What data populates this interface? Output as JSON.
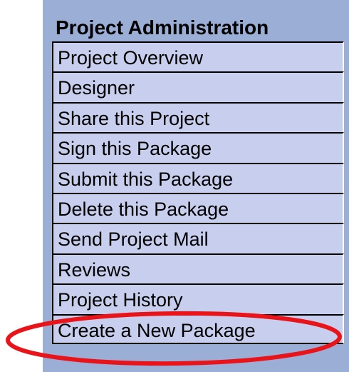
{
  "panel": {
    "title": "Project Administration",
    "background_color": "#9aaed6",
    "item_color": "#c8cfee"
  },
  "menu": {
    "items": [
      {
        "id": "project-overview",
        "label": "Project Overview"
      },
      {
        "id": "designer",
        "label": "Designer"
      },
      {
        "id": "share-this-project",
        "label": "Share this Project"
      },
      {
        "id": "sign-this-package",
        "label": "Sign this Package"
      },
      {
        "id": "submit-this-package",
        "label": "Submit this Package"
      },
      {
        "id": "delete-this-package",
        "label": "Delete this Package"
      },
      {
        "id": "send-project-mail",
        "label": "Send Project Mail"
      },
      {
        "id": "reviews",
        "label": "Reviews"
      },
      {
        "id": "project-history",
        "label": "Project History"
      },
      {
        "id": "create-a-new-package",
        "label": "Create a New Package"
      }
    ]
  },
  "annotation": {
    "highlighted_item": "create-a-new-package",
    "ring_color": "#e8141a"
  }
}
